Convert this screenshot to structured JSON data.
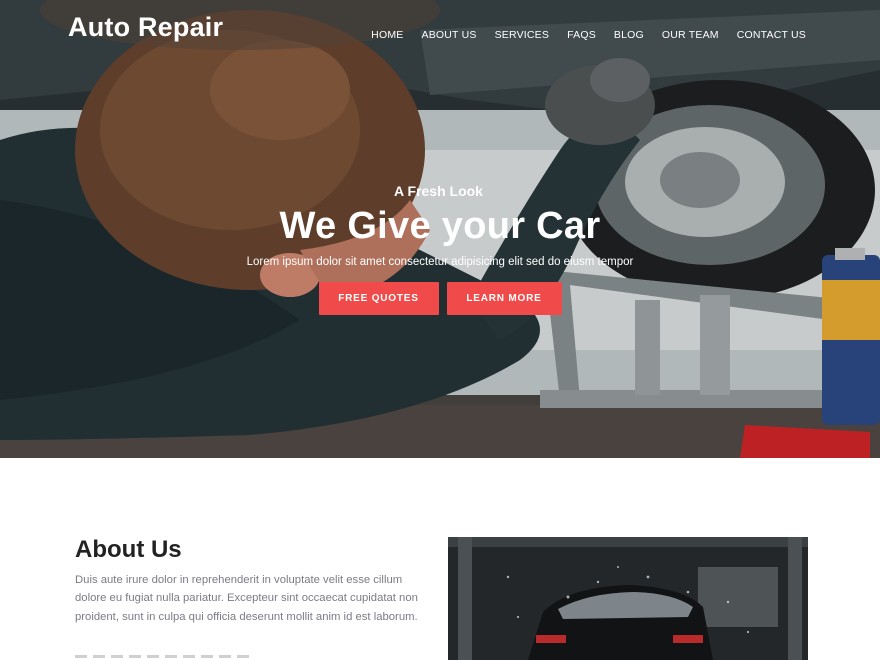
{
  "brand": {
    "title": "Auto Repair"
  },
  "nav": {
    "items": [
      "HOME",
      "ABOUT US",
      "SERVICES",
      "FAQS",
      "BLOG",
      "OUR TEAM",
      "CONTACT US"
    ]
  },
  "hero": {
    "kicker": "A Fresh Look",
    "headline": "We Give your Car",
    "subtitle": "Lorem ipsum dolor sit amet consectetur adipisicing elit sed do eiusm tempor",
    "primary_button": "FREE QUOTES",
    "secondary_button": "LEARN MORE",
    "image": "mechanic-under-car-photo",
    "accent_color": "#f04a4a"
  },
  "about": {
    "title": "About Us",
    "text": "Duis aute irure dolor in reprehenderit in voluptate velit esse cillum dolore eu fugiat nulla pariatur. Excepteur sint occaecat cupidatat non proident, sunt in culpa qui officia deserunt mollit anim id est laborum.",
    "image": "car-wash-photo"
  }
}
